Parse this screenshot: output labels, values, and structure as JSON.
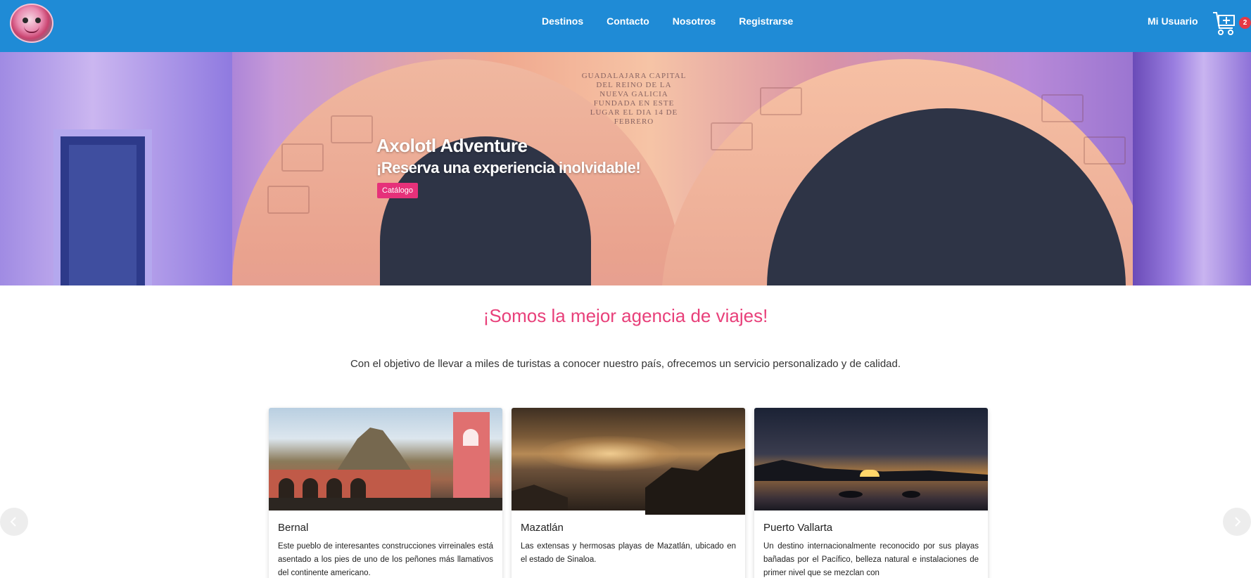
{
  "nav": {
    "links": [
      "Destinos",
      "Contacto",
      "Nosotros",
      "Registrarse"
    ],
    "user_label": "Mi Usuario",
    "cart_count": "2"
  },
  "hero": {
    "title": "Axolotl Adventure",
    "subtitle": "¡Reserva una experiencia inolvidable!",
    "button_label": "Catálogo",
    "inscription": "GUADALAJARA CAPITAL DEL REINO DE LA NUEVA GALICIA FUNDADA EN ESTE LUGAR EL DIA 14 DE FEBRERO"
  },
  "main": {
    "headline": "¡Somos la mejor agencia de viajes!",
    "intro": "Con el objetivo de llevar a miles de turistas a conocer nuestro país, ofrecemos un servicio personalizado y de calidad."
  },
  "cards": [
    {
      "title": "Bernal",
      "description": "Este pueblo de interesantes construcciones virreinales está asentado a los pies de uno de los peñones más llamativos del continente americano."
    },
    {
      "title": "Mazatlán",
      "description": "Las extensas y hermosas playas de Mazatlán, ubicado en el estado de Sinaloa."
    },
    {
      "title": "Puerto Vallarta",
      "description": "Un destino internacionalmente reconocido por sus playas bañadas por el Pacífico, belleza natural e instalaciones de primer nivel que se mezclan con"
    }
  ],
  "colors": {
    "navbar": "#1f8bd6",
    "accent_pink": "#e8407a",
    "button_pink": "#e6317a",
    "badge_red": "#e53945"
  },
  "icons": {
    "logo": "axolotl-logo",
    "cart": "cart-add-icon",
    "prev": "chevron-left-icon",
    "next": "chevron-right-icon"
  }
}
